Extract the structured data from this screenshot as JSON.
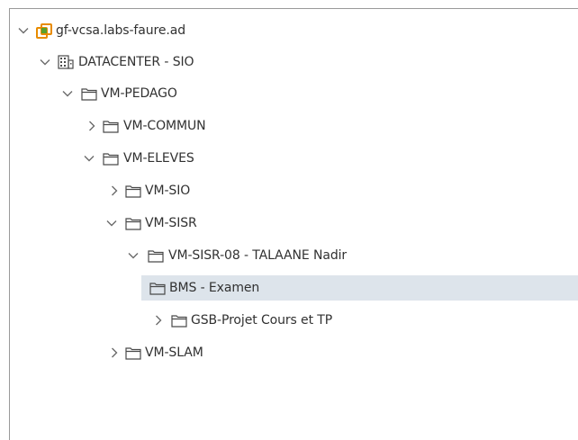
{
  "tree": {
    "nodes": [
      {
        "label": "gf-vcsa.labs-faure.ad",
        "icon": "vcenter-icon",
        "state": "expanded"
      },
      {
        "label": "DATACENTER - SIO",
        "icon": "datacenter-icon",
        "state": "expanded"
      },
      {
        "label": "VM-PEDAGO",
        "icon": "folder-icon",
        "state": "expanded"
      },
      {
        "label": "VM-COMMUN",
        "icon": "folder-icon",
        "state": "collapsed"
      },
      {
        "label": "VM-ELEVES",
        "icon": "folder-icon",
        "state": "expanded"
      },
      {
        "label": "VM-SIO",
        "icon": "folder-icon",
        "state": "collapsed"
      },
      {
        "label": "VM-SISR",
        "icon": "folder-icon",
        "state": "expanded"
      },
      {
        "label": "VM-SISR-08 - TALAANE Nadir",
        "icon": "folder-icon",
        "state": "expanded"
      },
      {
        "label": "BMS - Examen",
        "icon": "folder-icon",
        "state": "leaf",
        "selected": true
      },
      {
        "label": "GSB-Projet Cours et TP",
        "icon": "folder-icon",
        "state": "collapsed"
      },
      {
        "label": "VM-SLAM",
        "icon": "folder-icon",
        "state": "collapsed"
      }
    ]
  },
  "colors": {
    "selection": "#dde4eb",
    "vcenter_icon": "#e88b00",
    "vcenter_icon_accent": "#5aa02c",
    "tree_line": "#6b6b6b"
  }
}
